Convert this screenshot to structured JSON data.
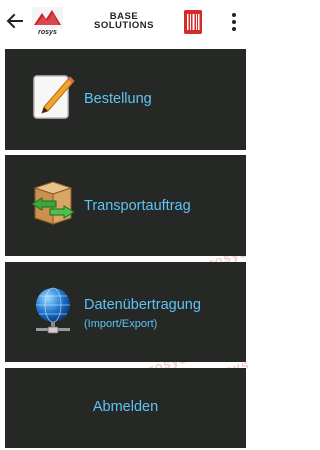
{
  "appbar": {
    "logo_left_text": "rosys",
    "brand_line1": "BASE",
    "brand_line2": "SOLUTIONS",
    "icons": [
      "back-arrow-icon",
      "barcode-icon",
      "more-vert-icon"
    ]
  },
  "background": {
    "watermark_text": "rosys"
  },
  "menu": {
    "items": [
      {
        "label": "Bestellung",
        "icon": "notepad-pencil-icon"
      },
      {
        "label": "Transportauftrag",
        "icon": "box-transfer-icon"
      },
      {
        "label": "Datenübertragung",
        "sublabel": "(Import/Export)",
        "icon": "globe-network-icon"
      },
      {
        "label": "Abmelden"
      }
    ]
  },
  "colors": {
    "tile_background": "#262826",
    "label_color": "#5fc3f7",
    "accent_red": "#d62b2b"
  }
}
